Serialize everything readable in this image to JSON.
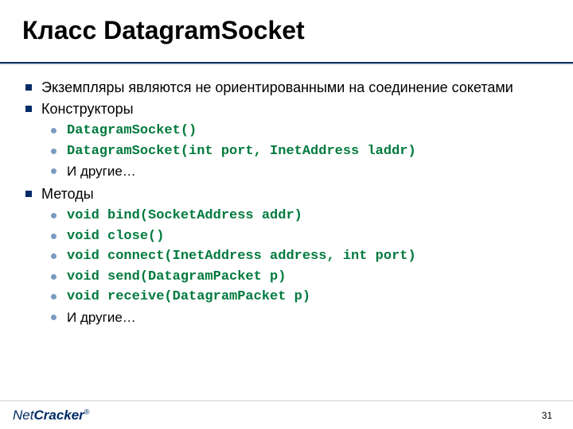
{
  "title": "Класс DatagramSocket",
  "bullets": {
    "b1": "Экземпляры являются не ориентированными на соединение сокетами",
    "b2": "Конструкторы",
    "b2_items": {
      "i1": "DatagramSocket()",
      "i2": "DatagramSocket(int port, InetAddress laddr)",
      "i3": "И другие…"
    },
    "b3": "Методы",
    "b3_items": {
      "i1": "void bind(SocketAddress addr)",
      "i2": "void close()",
      "i3": "void connect(InetAddress address, int port)",
      "i4": "void send(DatagramPacket p)",
      "i5": "void receive(DatagramPacket p)",
      "i6": "И другие…"
    }
  },
  "footer": {
    "logo_net": "Net",
    "logo_cracker": "Cracker",
    "logo_reg": "®",
    "page": "31"
  }
}
